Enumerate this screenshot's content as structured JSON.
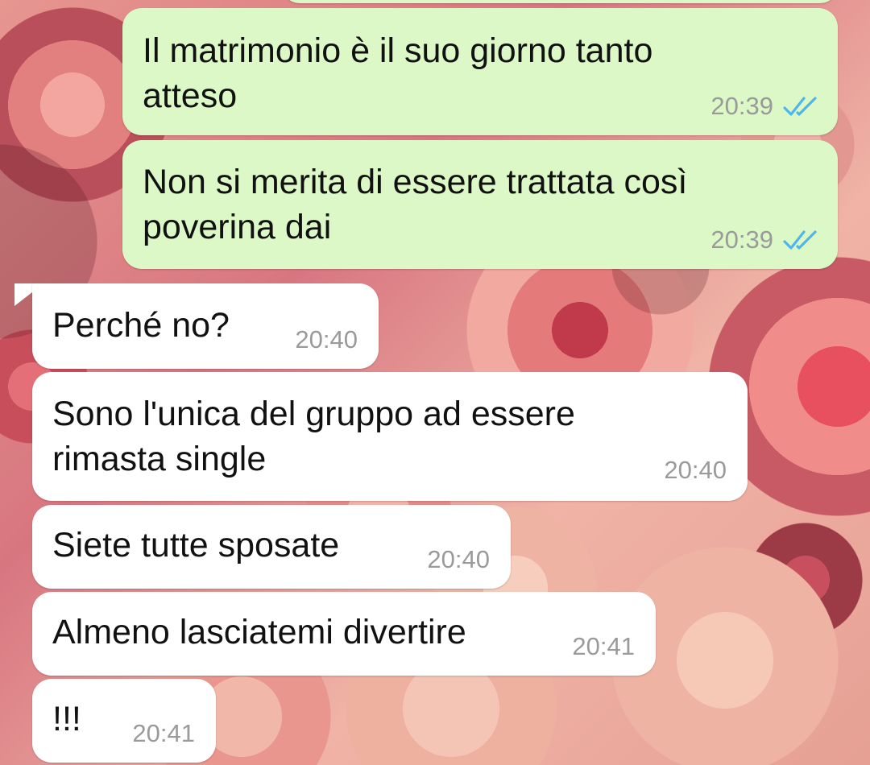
{
  "chat": {
    "messages": [
      {
        "direction": "outgoing",
        "text": "Il matrimonio è il suo giorno tanto\natteso",
        "time": "20:39",
        "status": "double-check-read"
      },
      {
        "direction": "outgoing",
        "text": "Non si merita di essere trattata così\npoverina dai",
        "time": "20:39",
        "status": "double-check-read"
      },
      {
        "direction": "incoming",
        "text": "Perché no?",
        "time": "20:40"
      },
      {
        "direction": "incoming",
        "text": "Sono l'unica del gruppo ad essere\nrimasta single",
        "time": "20:40"
      },
      {
        "direction": "incoming",
        "text": "Siete tutte sposate",
        "time": "20:40"
      },
      {
        "direction": "incoming",
        "text": "Almeno lasciatemi divertire",
        "time": "20:41"
      },
      {
        "direction": "incoming",
        "text": "!!!",
        "time": "20:41"
      }
    ]
  },
  "colors": {
    "outgoing_bubble": "#dcf8c6",
    "incoming_bubble": "#ffffff",
    "timestamp": "#9a9a9a",
    "read_ticks": "#4fb6ec"
  },
  "icons": {
    "read_status": "double-check-icon",
    "wallpaper": "roses-wallpaper"
  }
}
